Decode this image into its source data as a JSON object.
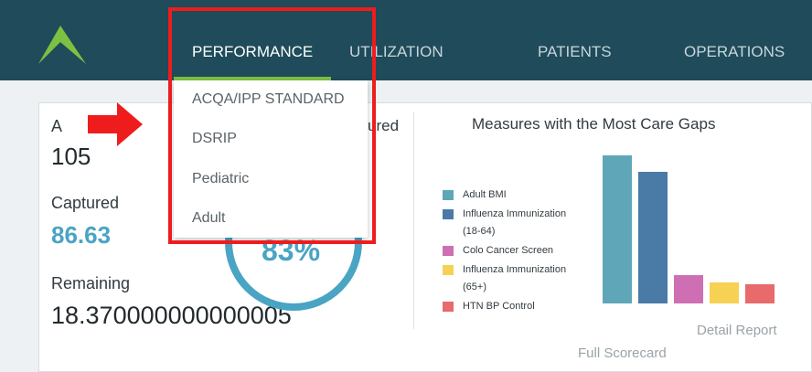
{
  "nav": {
    "items": [
      {
        "label": "PERFORMANCE"
      },
      {
        "label": "UTILIZATION"
      },
      {
        "label": "PATIENTS"
      },
      {
        "label": "OPERATIONS"
      }
    ]
  },
  "dropdown": {
    "items": [
      {
        "label": "ACQA/IPP STANDARD"
      },
      {
        "label": "DSRIP"
      },
      {
        "label": "Pediatric"
      },
      {
        "label": "Adult"
      }
    ]
  },
  "stats": {
    "first_label_visible": "A",
    "total_value": "105",
    "captured_label": "Captured",
    "captured_value": "86.63",
    "remaining_label": "Remaining",
    "remaining_value": "18.370000000000005",
    "partial_header": "ured"
  },
  "gauge": {
    "text": "83%"
  },
  "chart": {
    "title": "Measures with the Most Care Gaps",
    "detail_link": "Detail Report",
    "scorecard_link": "Full Scorecard"
  },
  "chart_data": {
    "type": "bar",
    "title": "Measures with the Most Care Gaps",
    "categories": [
      "Adult BMI",
      "Influenza Immunization (18-64)",
      "Colo Cancer Screen",
      "Influenza Immunization (65+)",
      "HTN BP Control"
    ],
    "values": [
      100,
      89,
      19,
      14,
      13
    ],
    "colors": [
      "#5fa7b8",
      "#4a7aa6",
      "#cf6fb3",
      "#f7d154",
      "#e86a6a"
    ],
    "ylim": [
      0,
      100
    ],
    "legend": "left",
    "grid": false
  },
  "colors": {
    "topbar": "#1f4b5a",
    "accent": "#7cc142",
    "captured": "#4aa4c4",
    "highlight": "#ee1c1c"
  }
}
